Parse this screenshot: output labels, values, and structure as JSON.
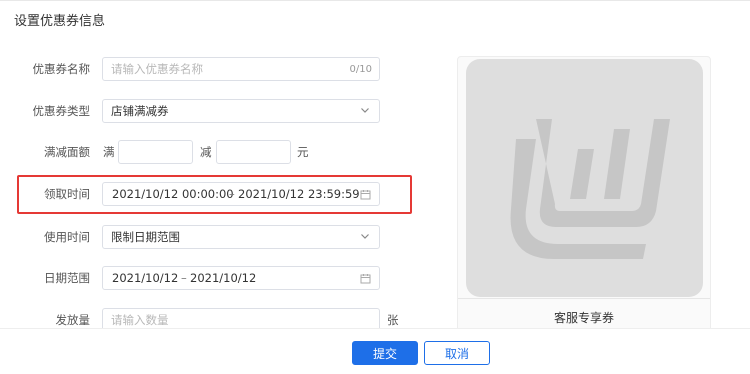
{
  "dialog": {
    "title": "设置优惠券信息"
  },
  "form": {
    "coupon_name": {
      "label": "优惠券名称",
      "placeholder": "请输入优惠券名称",
      "counter": "0/10"
    },
    "coupon_type": {
      "label": "优惠券类型",
      "value": "店铺满减券"
    },
    "threshold": {
      "label": "满减面额",
      "full_prefix": "满",
      "minus_prefix": "减",
      "unit": "元",
      "full_value": "",
      "minus_value": ""
    },
    "receive_time": {
      "label": "领取时间",
      "start": "2021/10/12 00:00:00",
      "sep": "–",
      "end": "2021/10/12 23:59:59"
    },
    "use_time": {
      "label": "使用时间",
      "value": "限制日期范围"
    },
    "date_range": {
      "label": "日期范围",
      "start": "2021/10/12",
      "sep": "–",
      "end": "2021/10/12"
    },
    "quantity": {
      "label": "发放量",
      "placeholder": "请输入数量",
      "unit": "张"
    }
  },
  "preview": {
    "title": "客服专享券"
  },
  "footer": {
    "submit_label": "提交",
    "cancel_label": "取消"
  },
  "colors": {
    "primary": "#1e6fe8",
    "highlight": "#e53935"
  }
}
